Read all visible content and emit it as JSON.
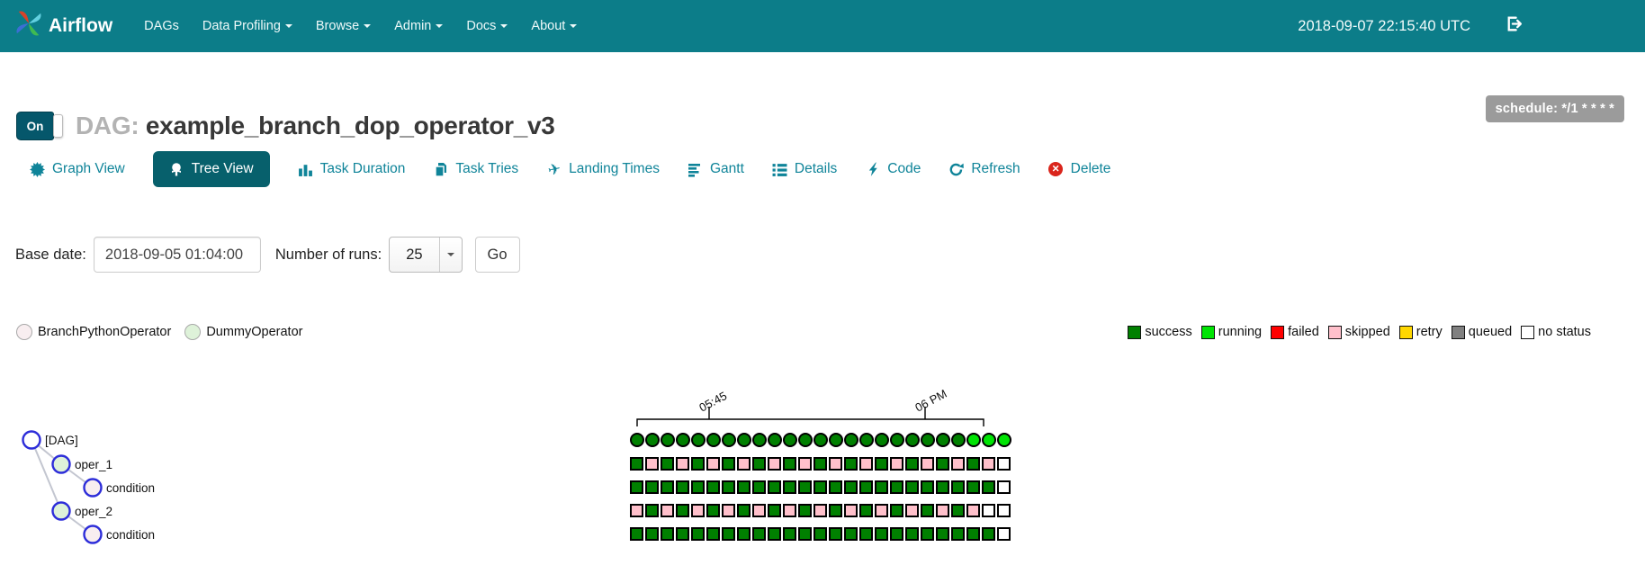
{
  "navbar": {
    "brand": "Airflow",
    "items": [
      {
        "label": "DAGs",
        "caret": false
      },
      {
        "label": "Data Profiling",
        "caret": true
      },
      {
        "label": "Browse",
        "caret": true
      },
      {
        "label": "Admin",
        "caret": true
      },
      {
        "label": "Docs",
        "caret": true
      },
      {
        "label": "About",
        "caret": true
      }
    ],
    "clock": "2018-09-07 22:15:40 UTC"
  },
  "header": {
    "toggle_label": "On",
    "dag_prefix": "DAG:",
    "dag_name": "example_branch_dop_operator_v3",
    "schedule_badge": "schedule: */1 * * * *"
  },
  "tabs": [
    {
      "label": "Graph View",
      "icon": "certificate-icon",
      "active": false
    },
    {
      "label": "Tree View",
      "icon": "tree-icon",
      "active": true
    },
    {
      "label": "Task Duration",
      "icon": "bar-chart-icon",
      "active": false
    },
    {
      "label": "Task Tries",
      "icon": "copy-icon",
      "active": false
    },
    {
      "label": "Landing Times",
      "icon": "plane-icon",
      "active": false
    },
    {
      "label": "Gantt",
      "icon": "align-left-icon",
      "active": false
    },
    {
      "label": "Details",
      "icon": "list-icon",
      "active": false
    },
    {
      "label": "Code",
      "icon": "bolt-icon",
      "active": false
    },
    {
      "label": "Refresh",
      "icon": "refresh-icon",
      "active": false
    },
    {
      "label": "Delete",
      "icon": "times-circle-icon",
      "active": false
    }
  ],
  "controls": {
    "base_date_label": "Base date:",
    "base_date_value": "2018-09-05 01:04:00",
    "num_runs_label": "Number of runs:",
    "num_runs_value": "25",
    "go_label": "Go"
  },
  "operator_legend": [
    {
      "label": "BranchPythonOperator",
      "fill": "#f8eef0"
    },
    {
      "label": "DummyOperator",
      "fill": "#def2d9"
    }
  ],
  "status_colors": {
    "success": "#008000",
    "running": "#00e404",
    "failed": "#ff0000",
    "skipped": "#ffc0cb",
    "retry": "#ffd700",
    "queued": "#808080",
    "no_status": "#ffffff"
  },
  "status_legend": [
    {
      "label": "success",
      "state": "success"
    },
    {
      "label": "running",
      "state": "running"
    },
    {
      "label": "failed",
      "state": "failed"
    },
    {
      "label": "skipped",
      "state": "skipped"
    },
    {
      "label": "retry",
      "state": "retry"
    },
    {
      "label": "queued",
      "state": "queued"
    },
    {
      "label": "no status",
      "state": "no_status"
    }
  ],
  "chart_axis": {
    "ticks": [
      "05:45",
      "06 PM"
    ]
  },
  "tree": {
    "nodes": [
      {
        "label": "[DAG]",
        "operator": "dag",
        "fill": "#ffffff"
      },
      {
        "label": "oper_1",
        "operator": "DummyOperator",
        "fill": "#def2d9"
      },
      {
        "label": "condition",
        "operator": "BranchPythonOperator",
        "fill": "#f8eef0"
      },
      {
        "label": "oper_2",
        "operator": "DummyOperator",
        "fill": "#def2d9"
      },
      {
        "label": "condition",
        "operator": "BranchPythonOperator",
        "fill": "#f8eef0"
      }
    ]
  },
  "grid": {
    "runs": 25,
    "cell_codes": {
      "G": "success",
      "L": "running",
      "P": "skipped",
      "W": "no_status"
    },
    "rows": [
      {
        "task": "[DAG]",
        "shape": "circle",
        "cells": "GGGGGGGGGGGGGGGGGGGGGGLLL"
      },
      {
        "task": "oper_1",
        "shape": "square",
        "cells": "GPGPGPGPGPGPGPGPGPGPGPGPW"
      },
      {
        "task": "condition",
        "shape": "square",
        "cells": "GGGGGGGGGGGGGGGGGGGGGGGGW"
      },
      {
        "task": "oper_2",
        "shape": "square",
        "cells": "PGPGPGPGPGPGPGPGPGPGPGPWW"
      },
      {
        "task": "condition",
        "shape": "square",
        "cells": "GGGGGGGGGGGGGGGGGGGGGGGGW"
      }
    ]
  }
}
